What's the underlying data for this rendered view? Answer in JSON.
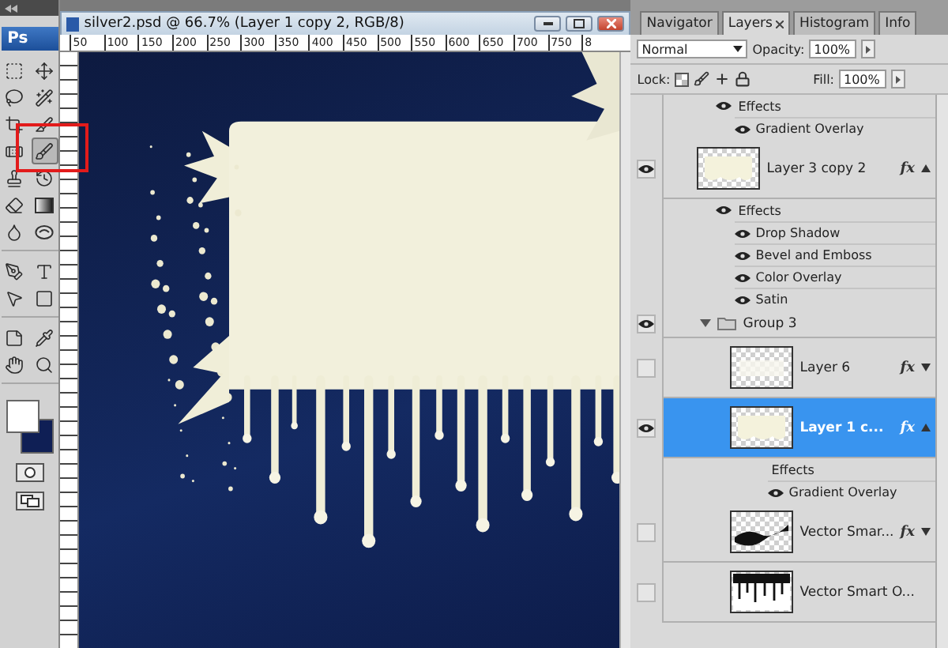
{
  "toolbox": {
    "logo": "Ps",
    "tool_groups": [
      [
        {
          "kind": "marquee",
          "selected": false
        },
        {
          "kind": "move",
          "selected": false
        },
        {
          "kind": "lasso",
          "selected": false
        },
        {
          "kind": "wand",
          "selected": false
        },
        {
          "kind": "crop",
          "selected": false
        },
        {
          "kind": "slice",
          "selected": false
        },
        {
          "kind": "healing",
          "selected": false
        },
        {
          "kind": "brush",
          "selected": true
        },
        {
          "kind": "stamp",
          "selected": false
        },
        {
          "kind": "history-brush",
          "selected": false
        },
        {
          "kind": "eraser",
          "selected": false
        },
        {
          "kind": "gradient",
          "selected": false
        },
        {
          "kind": "blur",
          "selected": false
        },
        {
          "kind": "dodge",
          "selected": false
        }
      ],
      [
        {
          "kind": "pen",
          "selected": false
        },
        {
          "kind": "type",
          "selected": false
        },
        {
          "kind": "path-select",
          "selected": false
        },
        {
          "kind": "shape",
          "selected": false
        }
      ],
      [
        {
          "kind": "notes",
          "selected": false
        },
        {
          "kind": "eyedropper",
          "selected": false
        },
        {
          "kind": "hand",
          "selected": false
        },
        {
          "kind": "zoom",
          "selected": false
        }
      ]
    ]
  },
  "document": {
    "title": "silver2.psd @ 66.7% (Layer 1 copy 2, RGB/8)",
    "ruler_labels": [
      "50",
      "100",
      "150",
      "200",
      "250",
      "300",
      "350",
      "400",
      "450",
      "500",
      "550",
      "600",
      "650",
      "700",
      "750",
      "8"
    ]
  },
  "layers_panel": {
    "tabs": [
      {
        "label": "Navigator",
        "selected": false,
        "closable": false
      },
      {
        "label": "Layers",
        "selected": true,
        "closable": true
      },
      {
        "label": "Histogram",
        "selected": false,
        "closable": false
      },
      {
        "label": "Info",
        "selected": false,
        "closable": false
      }
    ],
    "blend_mode": "Normal",
    "opacity_label": "Opacity:",
    "opacity": "100%",
    "lock_label": "Lock:",
    "fill_label": "Fill:",
    "fill": "100%",
    "layers": [
      {
        "kind": "effects",
        "label": "Effects",
        "visible": true,
        "children": [
          {
            "label": "Gradient Overlay",
            "visible": true
          }
        ]
      },
      {
        "kind": "layer",
        "name": "Layer 3 copy 2",
        "visible": true,
        "selected": false,
        "thumbnail": {
          "kind": "cream"
        },
        "fx_label": "fx",
        "effects_expanded": true
      },
      {
        "kind": "effects",
        "label": "Effects",
        "visible": true,
        "children": [
          {
            "label": "Drop Shadow",
            "visible": true
          },
          {
            "label": "Bevel and Emboss",
            "visible": true
          },
          {
            "label": "Color Overlay",
            "visible": true
          },
          {
            "label": "Satin",
            "visible": true
          }
        ]
      },
      {
        "kind": "group",
        "name": "Group 3",
        "visible": true,
        "expanded": true,
        "children": [
          {
            "kind": "layer",
            "name": "Layer 6",
            "visible": false,
            "selected": false,
            "thumbnail": {
              "kind": "white"
            },
            "fx_label": "fx",
            "effects_expanded": false
          },
          {
            "kind": "layer",
            "name": "Layer 1 c...",
            "visible": true,
            "selected": true,
            "thumbnail": {
              "kind": "cream"
            },
            "fx_label": "fx",
            "effects_expanded": true
          },
          {
            "kind": "effects",
            "label": "Effects",
            "visible": false,
            "children": [
              {
                "label": "Gradient Overlay",
                "visible": true
              }
            ]
          },
          {
            "kind": "layer",
            "name": "Vector Smar...",
            "visible": false,
            "selected": false,
            "thumbnail": {
              "kind": "wave"
            },
            "fx_label": "fx",
            "effects_expanded": false
          },
          {
            "kind": "layer",
            "name": "Vector Smart O...",
            "visible": false,
            "selected": false,
            "thumbnail": {
              "kind": "drips"
            }
          }
        ]
      }
    ]
  }
}
